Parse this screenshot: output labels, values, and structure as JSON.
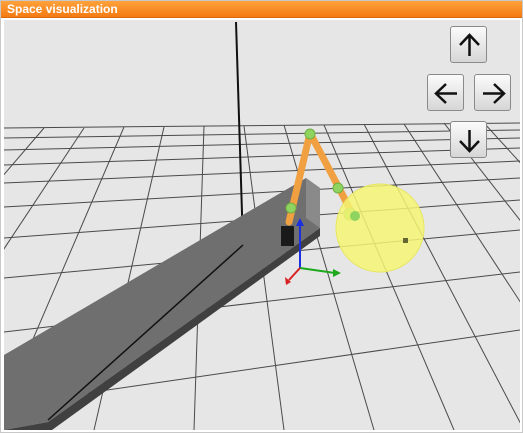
{
  "panel": {
    "title": "Space visualization"
  },
  "navigation": {
    "up": {
      "icon": "arrow-up-icon"
    },
    "left": {
      "icon": "arrow-left-icon"
    },
    "right": {
      "icon": "arrow-right-icon"
    },
    "down": {
      "icon": "arrow-down-icon"
    }
  },
  "scene": {
    "background_color": "#e6e6e6",
    "grid_color": "#4a4a4a",
    "beam_color": "#6f6f6f",
    "arm_color": "#f0a040",
    "joint_color": "#8fd460",
    "target_sphere_color": "#f4f474",
    "axis_x_color": "#1ea81e",
    "axis_y_color": "#1a2fe0",
    "axis_z_color": "#d82020"
  }
}
